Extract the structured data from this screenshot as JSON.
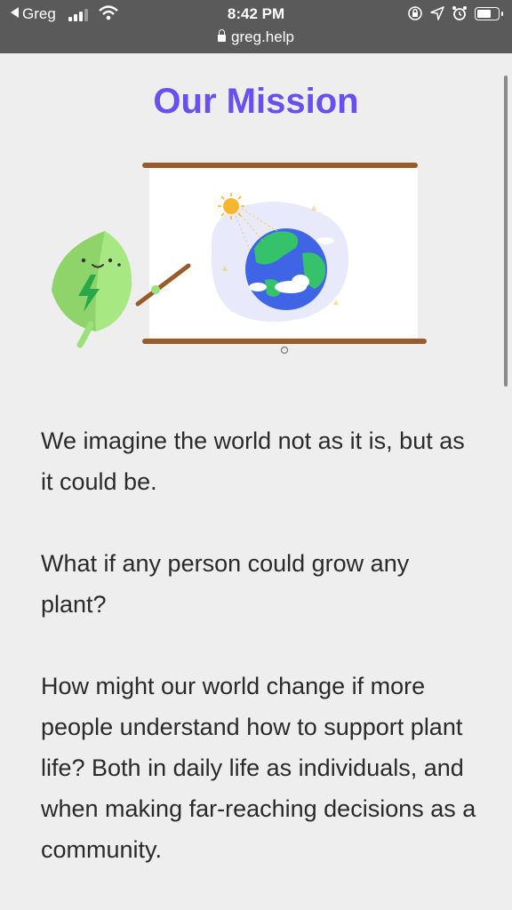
{
  "status_bar": {
    "back_label": "Greg",
    "time": "8:42 PM",
    "url": "greg.help"
  },
  "page": {
    "title": "Our Mission",
    "paragraphs": [
      "We imagine the world not as it is, but as it could be.",
      "What if any person could grow any plant?",
      "How might our world change if more people understand how to support plant life? Both in daily life as individuals, and when making far-reaching decisions as a community."
    ]
  },
  "icons": [
    "back-arrow-icon",
    "signal-icon",
    "wifi-icon",
    "lock-icon",
    "orientation-lock-icon",
    "location-icon",
    "alarm-icon",
    "battery-icon",
    "leaf-mascot-icon",
    "earth-icon",
    "sun-icon"
  ],
  "colors": {
    "status_bar": "#5a5a5a",
    "title": "#6a4ff0",
    "background": "#eeeeee",
    "board_frame": "#9b5a2a",
    "leaf": "#9be07a"
  }
}
